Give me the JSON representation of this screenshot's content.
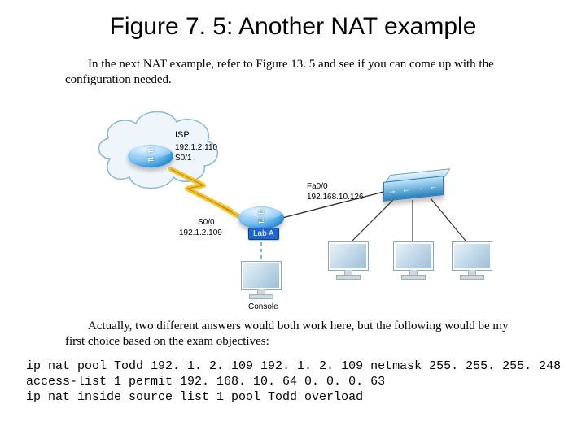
{
  "title": "Figure 7. 5: Another NAT example",
  "paragraph1": "In the next NAT example, refer to Figure 13. 5 and see if you can come up with the configuration needed.",
  "paragraph2": "Actually, two different answers would both work here, but the following would be my first choice based on the exam objectives:",
  "code": "ip nat pool Todd 192. 1. 2. 109 192. 1. 2. 109 netmask 255. 255. 255. 248\naccess-list 1 permit 192. 168. 10. 64 0. 0. 0. 63\nip nat inside source list 1 pool Todd overload",
  "diagram": {
    "isp_label": "ISP",
    "isp_ip": "192.1.2.110",
    "isp_if": "S0/1",
    "labA_s_if": "S0/0",
    "labA_s_ip": "192.1.2.109",
    "labA_name": "Lab A",
    "labA_fa_if": "Fa0/0",
    "labA_fa_ip": "192.168.10.126",
    "console_label": "Console"
  },
  "chart_data": {
    "type": "network-diagram",
    "nodes": [
      {
        "id": "isp",
        "type": "router",
        "label": "ISP",
        "in_cloud": true,
        "interfaces": [
          {
            "name": "S0/1",
            "ip": "192.1.2.110",
            "peer": "labA:S0/0"
          }
        ]
      },
      {
        "id": "labA",
        "type": "router",
        "label": "Lab A",
        "interfaces": [
          {
            "name": "S0/0",
            "ip": "192.1.2.109",
            "peer": "isp:S0/1",
            "link": "serial"
          },
          {
            "name": "Fa0/0",
            "ip": "192.168.10.126",
            "peer": "sw1",
            "link": "ethernet"
          }
        ]
      },
      {
        "id": "sw1",
        "type": "switch"
      },
      {
        "id": "pc1",
        "type": "host",
        "link_to": "sw1"
      },
      {
        "id": "pc2",
        "type": "host",
        "link_to": "sw1"
      },
      {
        "id": "pc3",
        "type": "host",
        "link_to": "sw1"
      },
      {
        "id": "console_pc",
        "type": "host",
        "label": "Console",
        "link_to": "labA",
        "link": "console"
      }
    ],
    "links": [
      {
        "a": "isp:S0/1",
        "b": "labA:S0/0",
        "type": "serial",
        "style": "lightning"
      },
      {
        "a": "labA:Fa0/0",
        "b": "sw1",
        "type": "ethernet",
        "style": "solid"
      },
      {
        "a": "labA",
        "b": "console_pc",
        "type": "console",
        "style": "dashed"
      },
      {
        "a": "sw1",
        "b": "pc1",
        "type": "ethernet",
        "style": "solid"
      },
      {
        "a": "sw1",
        "b": "pc2",
        "type": "ethernet",
        "style": "solid"
      },
      {
        "a": "sw1",
        "b": "pc3",
        "type": "ethernet",
        "style": "solid"
      }
    ]
  }
}
